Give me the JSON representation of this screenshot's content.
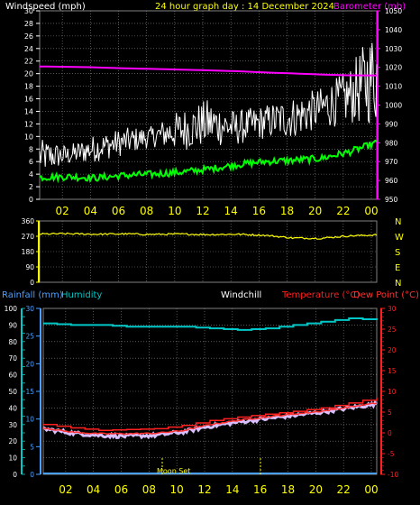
{
  "title": "24 hour graph day : 14 December 2024",
  "xticks": [
    "02",
    "04",
    "06",
    "08",
    "10",
    "12",
    "14",
    "16",
    "18",
    "20",
    "22",
    "00"
  ],
  "colors": {
    "background": "#000000",
    "frame": "#808080",
    "grid": "#8a8a8a",
    "title": "#ffff00",
    "axis_text": "#ffffff",
    "wind_speed": "#ffffff",
    "wind_gust": "#ffffff",
    "wind_avg": "#00ff00",
    "barometer": "#ff00ff",
    "direction": "#ffff00",
    "rain": "#4aa0ff",
    "humidity": "#00c8c8",
    "windchill": "#ffffff",
    "temperature": "#ff2020",
    "dewpoint": "#ff3030",
    "windchill_line": "#d8c0ff"
  },
  "chart_data": [
    {
      "type": "line",
      "title": "24 hour graph day : 14 December 2024",
      "ylabel": "Windspeed (mph)",
      "ylim": [
        0,
        30
      ],
      "yticks": [
        "0",
        "2",
        "4",
        "6",
        "8",
        "10",
        "12",
        "14",
        "16",
        "18",
        "20",
        "22",
        "24",
        "26",
        "28",
        "30"
      ],
      "y2label": "Barometer (mb)",
      "y2lim": [
        950,
        1050
      ],
      "y2ticks": [
        "950",
        "960",
        "970",
        "980",
        "990",
        "1000",
        "1010",
        "1020",
        "1030",
        "1040",
        "1050"
      ],
      "x": [
        "00",
        "02",
        "04",
        "06",
        "08",
        "10",
        "12",
        "14",
        "16",
        "18",
        "20",
        "22",
        "00"
      ],
      "series": [
        {
          "key": "gust",
          "values": [
            8.5,
            8.0,
            9.5,
            10.5,
            11.0,
            13.0,
            14.5,
            13.0,
            14.0,
            15.0,
            16.5,
            19.0,
            25.0
          ]
        },
        {
          "key": "speed",
          "values": [
            6.0,
            6.5,
            7.5,
            8.5,
            9.5,
            10.0,
            11.0,
            10.5,
            11.5,
            12.0,
            13.5,
            15.0,
            17.5
          ]
        },
        {
          "key": "average",
          "values": [
            3.5,
            3.6,
            3.4,
            3.8,
            4.0,
            4.3,
            4.8,
            5.5,
            6.0,
            6.2,
            6.5,
            7.5,
            9.0
          ]
        },
        {
          "key": "barometer",
          "values": [
            1020.5,
            1020.3,
            1020.0,
            1019.5,
            1019.2,
            1018.8,
            1018.4,
            1018.0,
            1017.3,
            1016.8,
            1016.2,
            1015.8,
            1015.7
          ]
        }
      ]
    },
    {
      "type": "line",
      "ylim": [
        0,
        360
      ],
      "yticks": [
        "0",
        "90",
        "180",
        "270",
        "360"
      ],
      "y2ticks": [
        "N",
        "E",
        "S",
        "W",
        "N"
      ],
      "x": [
        "00",
        "02",
        "04",
        "06",
        "08",
        "10",
        "12",
        "14",
        "16",
        "18",
        "20",
        "22",
        "00"
      ],
      "series": [
        {
          "key": "direction",
          "values": [
            283,
            285,
            282,
            284,
            281,
            283,
            280,
            282,
            276,
            260,
            258,
            272,
            278
          ]
        }
      ]
    },
    {
      "type": "line",
      "labels": {
        "rain": "Rainfall (mm)",
        "humidity": "Humidity",
        "windchill": "Windchill",
        "temperature": "Temperature (°C)",
        "dewpoint": "Dew Point (°C)"
      },
      "ylim": [
        0,
        100
      ],
      "yticks": [
        "0",
        "10",
        "20",
        "30",
        "40",
        "50",
        "60",
        "70",
        "80",
        "90",
        "100"
      ],
      "rain_ticks": [
        "0",
        "5",
        "10",
        "15",
        "20",
        "25",
        "30"
      ],
      "y2lim": [
        -10,
        30
      ],
      "y2ticks": [
        "-10",
        "-5",
        "0",
        "5",
        "10",
        "15",
        "20",
        "25",
        "30"
      ],
      "x": [
        "00",
        "02",
        "04",
        "06",
        "08",
        "10",
        "12",
        "14",
        "16",
        "18",
        "20",
        "22",
        "00"
      ],
      "annotation": "Moon Set",
      "series": [
        {
          "key": "humidity",
          "values": [
            91,
            90,
            90,
            89,
            89,
            89,
            88,
            87,
            88,
            90,
            92,
            94,
            93
          ]
        },
        {
          "key": "temperature",
          "values": [
            2.0,
            1.2,
            0.6,
            0.8,
            1.0,
            1.8,
            3.0,
            3.8,
            4.5,
            5.2,
            6.0,
            7.2,
            8.5
          ]
        },
        {
          "key": "dewpoint",
          "values": [
            1.2,
            0.2,
            -0.2,
            -0.2,
            -0.1,
            0.5,
            2.0,
            3.0,
            3.8,
            4.5,
            5.2,
            6.2,
            7.2
          ]
        },
        {
          "key": "windchill",
          "values": [
            1.0,
            0.0,
            -0.6,
            -0.8,
            -0.6,
            0.2,
            1.6,
            2.6,
            3.4,
            4.2,
            5.0,
            6.0,
            7.0
          ]
        },
        {
          "key": "rain",
          "values": [
            0,
            0,
            0,
            0,
            0,
            0,
            0,
            0,
            0,
            0,
            0,
            0,
            0
          ]
        }
      ]
    }
  ]
}
